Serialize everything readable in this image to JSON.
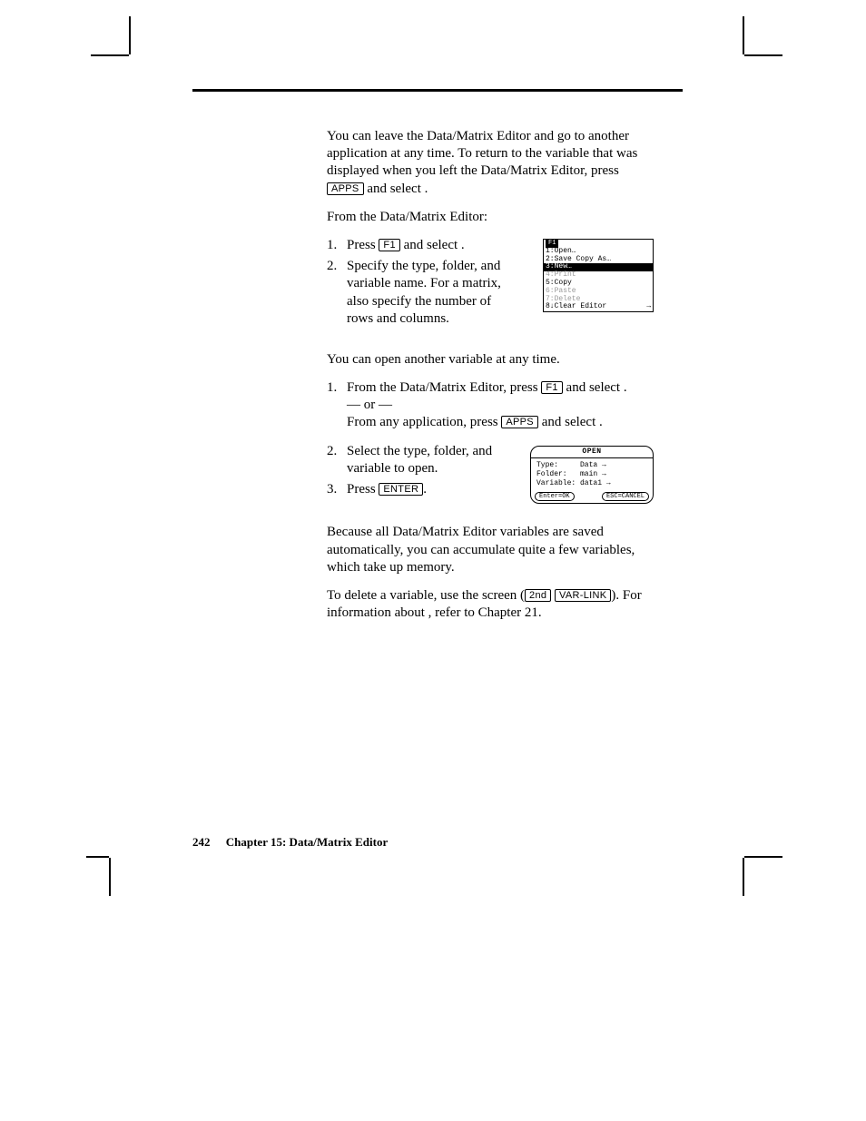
{
  "keys": {
    "apps": "APPS",
    "f1": "F1",
    "enter": "ENTER",
    "second": "2nd",
    "varlink": "VAR-LINK"
  },
  "p1": {
    "a": "You can leave the Data/Matrix Editor and go to another application at any time. To return to the variable that was displayed when you left the Data/Matrix Editor, press ",
    "b": " and select ",
    "c": "."
  },
  "s1": {
    "heading": "From the Data/Matrix Editor:",
    "step1a": "Press ",
    "step1b": " and select ",
    "step1c": ".",
    "step2": "Specify the type, folder, and variable name. For a matrix, also specify the number of rows and columns."
  },
  "menu": {
    "tab": "F1",
    "i1": "1:Open…",
    "i2": "2:Save Copy As…",
    "i3": "3:New…",
    "i4": "4:Print",
    "i5": "5:Copy",
    "i6": "6:Paste",
    "i7": "7:Delete",
    "i8": "8↓Clear Editor",
    "arrow": "→"
  },
  "p2": "You can open another variable at any time.",
  "s2": {
    "step1a": "From the Data/Matrix Editor, press ",
    "step1b": " and select ",
    "step1c": ".",
    "or": "— or —",
    "step1d": "From any application, press ",
    "step1e": " and select ",
    "step1f": ".",
    "step2": "Select the type, folder, and variable to open.",
    "step3a": "Press ",
    "step3b": "."
  },
  "dlg": {
    "title": "OPEN",
    "l1": "Type:     Data →",
    "l2": "Folder:   main →",
    "l3": "Variable: data1 →",
    "ok": "Enter=OK",
    "cancel": "ESC=CANCEL"
  },
  "p3": "Because all Data/Matrix Editor variables are saved automatically, you can accumulate quite a few variables, which take up memory.",
  "p4": {
    "a": "To delete a variable, use the ",
    "b": " screen (",
    "c": "). For information about ",
    "d": ", refer to Chapter 21."
  },
  "footer": {
    "page": "242",
    "chapter": "Chapter 15: Data/Matrix Editor"
  }
}
